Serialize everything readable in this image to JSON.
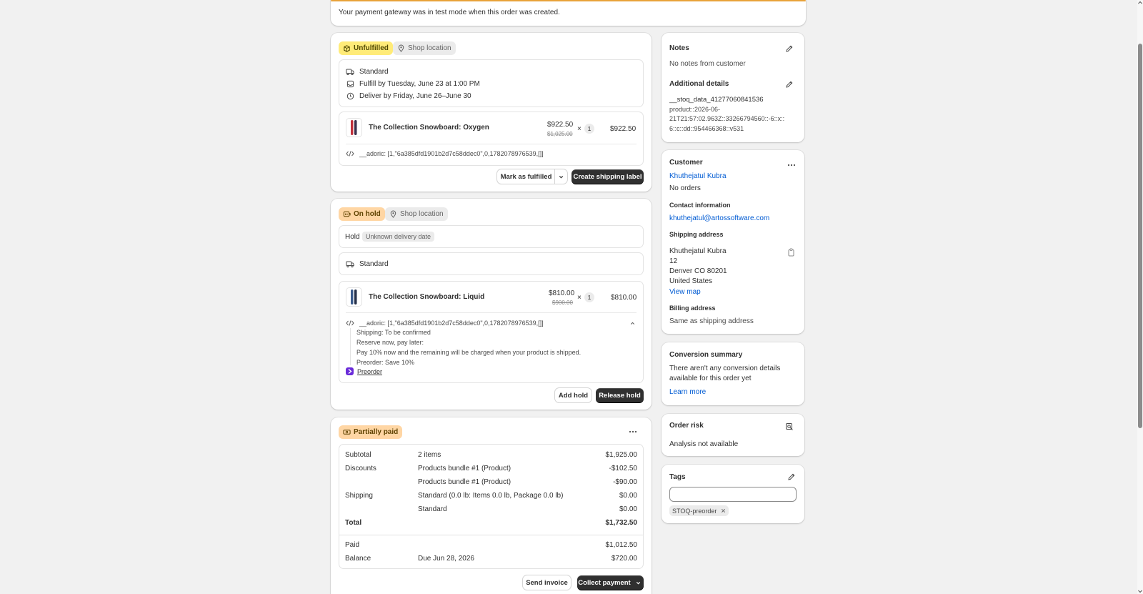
{
  "banner": {
    "text": "Your payment gateway was in test mode when this order was created."
  },
  "fulfillment": {
    "status_badge": "Unfulfilled",
    "location_badge": "Shop location",
    "method": "Standard",
    "fulfill_by": "Fulfill by Tuesday, June 23 at 1:00 PM",
    "deliver_by": "Deliver by Friday, June 26–June 30",
    "product": {
      "name": "The Collection Snowboard: Oxygen",
      "price": "$922.50",
      "compare_price": "$1,025.00",
      "times": "×",
      "qty": "1",
      "total": "$922.50"
    },
    "property": "__adoric: [1,\"6a385dfd1901b2d7c58ddec0\",0,1782078976539,[]]",
    "mark_fulfilled": "Mark as fulfilled",
    "create_label": "Create shipping label"
  },
  "hold": {
    "status_badge": "On hold",
    "location_badge": "Shop location",
    "hold_label": "Hold",
    "hold_reason": "Unknown delivery date",
    "method": "Standard",
    "product": {
      "name": "The Collection Snowboard: Liquid",
      "price": "$810.00",
      "compare_price": "$900.00",
      "times": "×",
      "qty": "1",
      "total": "$810.00"
    },
    "properties": [
      "__adoric: [1,\"6a385dfd1901b2d7c58ddec0\",0,1782078976539,[]]",
      "Shipping: To be confirmed",
      "Reserve now, pay later:",
      "Pay 10% now and the remaining will be charged when your product is shipped.",
      "Preorder: Save 10%"
    ],
    "app_link": "Preorder",
    "add_hold": "Add hold",
    "release_hold": "Release hold"
  },
  "payment": {
    "status_badge": "Partially paid",
    "rows": [
      {
        "label": "Subtotal",
        "desc": "2 items",
        "amount": "$1,925.00"
      },
      {
        "label": "Discounts",
        "desc": "Products bundle #1 (Product)",
        "amount": "-$102.50"
      },
      {
        "label": "",
        "desc": "Products bundle #1 (Product)",
        "amount": "-$90.00"
      },
      {
        "label": "Shipping",
        "desc": "Standard (0.0 lb: Items 0.0 lb, Package 0.0 lb)",
        "amount": "$0.00"
      },
      {
        "label": "",
        "desc": "Standard",
        "amount": "$0.00"
      }
    ],
    "total_label": "Total",
    "total_amount": "$1,732.50",
    "paid_label": "Paid",
    "paid_amount": "$1,012.50",
    "balance_label": "Balance",
    "balance_desc": "Due Jun 28, 2026",
    "balance_amount": "$720.00",
    "send_invoice": "Send invoice",
    "collect_payment": "Collect payment"
  },
  "notes": {
    "title": "Notes",
    "text": "No notes from customer",
    "additional_title": "Additional details",
    "additional_lines": [
      "__stoq_data_41277060841536",
      "product::2026-06-",
      "21T21:57:02.963Z::33266794560::-6::x::",
      "6::c::dd::954466368::v531"
    ]
  },
  "customer": {
    "title": "Customer",
    "name": "Khuthejatul Kubra",
    "orders": "No orders",
    "contact_title": "Contact information",
    "email": "khuthejatul@artossoftware.com",
    "shipping_title": "Shipping address",
    "address": [
      "Khuthejatul Kubra",
      "12",
      "Denver CO 80201",
      "United States"
    ],
    "view_map": "View map",
    "billing_title": "Billing address",
    "billing_text": "Same as shipping address"
  },
  "conversion": {
    "title": "Conversion summary",
    "lines": [
      "There aren't any conversion details",
      "available for this order yet"
    ],
    "learn_more": "Learn more"
  },
  "risk": {
    "title": "Order risk",
    "text": "Analysis not available"
  },
  "tags": {
    "title": "Tags",
    "input_value": "",
    "items": [
      "STOQ-preorder"
    ]
  },
  "colors": {
    "accent_link": "#005bd3",
    "primary_button": "#303030",
    "unfulfilled_badge": "#ffeb78",
    "hold_badge": "#ffd6a4",
    "banner_border": "#e8a23a"
  }
}
